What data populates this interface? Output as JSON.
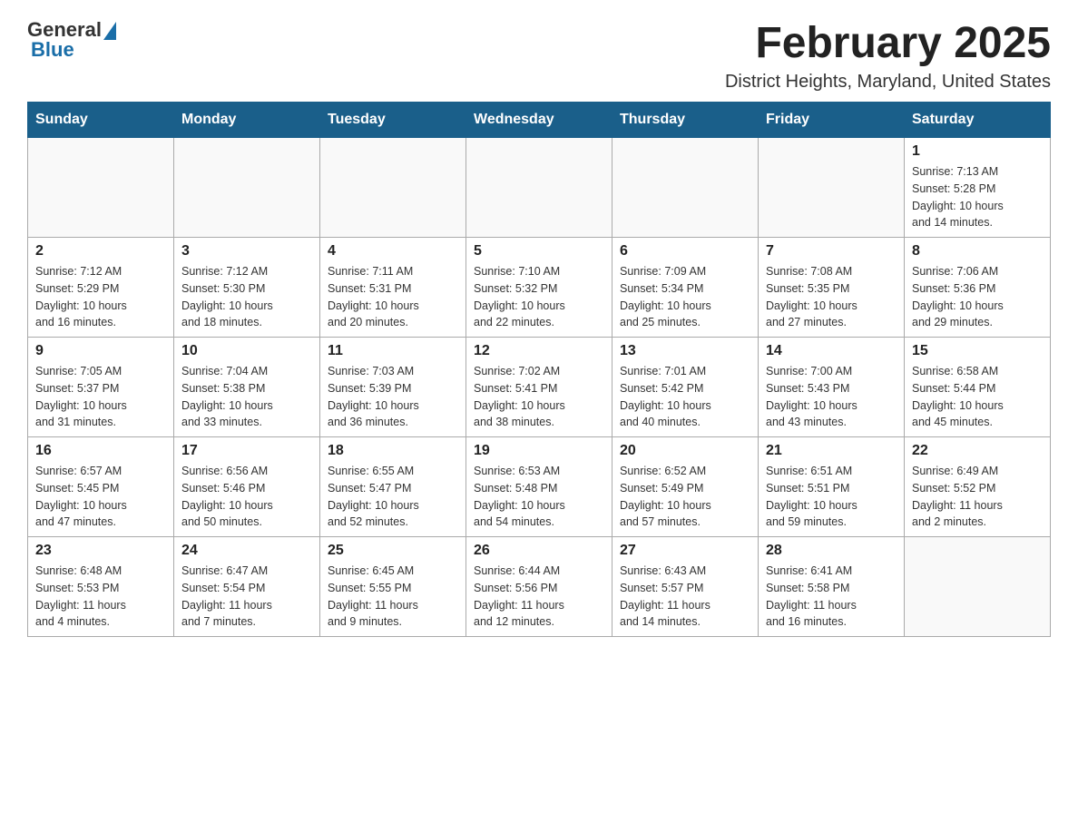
{
  "header": {
    "logo_general": "General",
    "logo_blue": "Blue",
    "title": "February 2025",
    "subtitle": "District Heights, Maryland, United States"
  },
  "days_of_week": [
    "Sunday",
    "Monday",
    "Tuesday",
    "Wednesday",
    "Thursday",
    "Friday",
    "Saturday"
  ],
  "weeks": [
    [
      {
        "day": "",
        "info": ""
      },
      {
        "day": "",
        "info": ""
      },
      {
        "day": "",
        "info": ""
      },
      {
        "day": "",
        "info": ""
      },
      {
        "day": "",
        "info": ""
      },
      {
        "day": "",
        "info": ""
      },
      {
        "day": "1",
        "info": "Sunrise: 7:13 AM\nSunset: 5:28 PM\nDaylight: 10 hours\nand 14 minutes."
      }
    ],
    [
      {
        "day": "2",
        "info": "Sunrise: 7:12 AM\nSunset: 5:29 PM\nDaylight: 10 hours\nand 16 minutes."
      },
      {
        "day": "3",
        "info": "Sunrise: 7:12 AM\nSunset: 5:30 PM\nDaylight: 10 hours\nand 18 minutes."
      },
      {
        "day": "4",
        "info": "Sunrise: 7:11 AM\nSunset: 5:31 PM\nDaylight: 10 hours\nand 20 minutes."
      },
      {
        "day": "5",
        "info": "Sunrise: 7:10 AM\nSunset: 5:32 PM\nDaylight: 10 hours\nand 22 minutes."
      },
      {
        "day": "6",
        "info": "Sunrise: 7:09 AM\nSunset: 5:34 PM\nDaylight: 10 hours\nand 25 minutes."
      },
      {
        "day": "7",
        "info": "Sunrise: 7:08 AM\nSunset: 5:35 PM\nDaylight: 10 hours\nand 27 minutes."
      },
      {
        "day": "8",
        "info": "Sunrise: 7:06 AM\nSunset: 5:36 PM\nDaylight: 10 hours\nand 29 minutes."
      }
    ],
    [
      {
        "day": "9",
        "info": "Sunrise: 7:05 AM\nSunset: 5:37 PM\nDaylight: 10 hours\nand 31 minutes."
      },
      {
        "day": "10",
        "info": "Sunrise: 7:04 AM\nSunset: 5:38 PM\nDaylight: 10 hours\nand 33 minutes."
      },
      {
        "day": "11",
        "info": "Sunrise: 7:03 AM\nSunset: 5:39 PM\nDaylight: 10 hours\nand 36 minutes."
      },
      {
        "day": "12",
        "info": "Sunrise: 7:02 AM\nSunset: 5:41 PM\nDaylight: 10 hours\nand 38 minutes."
      },
      {
        "day": "13",
        "info": "Sunrise: 7:01 AM\nSunset: 5:42 PM\nDaylight: 10 hours\nand 40 minutes."
      },
      {
        "day": "14",
        "info": "Sunrise: 7:00 AM\nSunset: 5:43 PM\nDaylight: 10 hours\nand 43 minutes."
      },
      {
        "day": "15",
        "info": "Sunrise: 6:58 AM\nSunset: 5:44 PM\nDaylight: 10 hours\nand 45 minutes."
      }
    ],
    [
      {
        "day": "16",
        "info": "Sunrise: 6:57 AM\nSunset: 5:45 PM\nDaylight: 10 hours\nand 47 minutes."
      },
      {
        "day": "17",
        "info": "Sunrise: 6:56 AM\nSunset: 5:46 PM\nDaylight: 10 hours\nand 50 minutes."
      },
      {
        "day": "18",
        "info": "Sunrise: 6:55 AM\nSunset: 5:47 PM\nDaylight: 10 hours\nand 52 minutes."
      },
      {
        "day": "19",
        "info": "Sunrise: 6:53 AM\nSunset: 5:48 PM\nDaylight: 10 hours\nand 54 minutes."
      },
      {
        "day": "20",
        "info": "Sunrise: 6:52 AM\nSunset: 5:49 PM\nDaylight: 10 hours\nand 57 minutes."
      },
      {
        "day": "21",
        "info": "Sunrise: 6:51 AM\nSunset: 5:51 PM\nDaylight: 10 hours\nand 59 minutes."
      },
      {
        "day": "22",
        "info": "Sunrise: 6:49 AM\nSunset: 5:52 PM\nDaylight: 11 hours\nand 2 minutes."
      }
    ],
    [
      {
        "day": "23",
        "info": "Sunrise: 6:48 AM\nSunset: 5:53 PM\nDaylight: 11 hours\nand 4 minutes."
      },
      {
        "day": "24",
        "info": "Sunrise: 6:47 AM\nSunset: 5:54 PM\nDaylight: 11 hours\nand 7 minutes."
      },
      {
        "day": "25",
        "info": "Sunrise: 6:45 AM\nSunset: 5:55 PM\nDaylight: 11 hours\nand 9 minutes."
      },
      {
        "day": "26",
        "info": "Sunrise: 6:44 AM\nSunset: 5:56 PM\nDaylight: 11 hours\nand 12 minutes."
      },
      {
        "day": "27",
        "info": "Sunrise: 6:43 AM\nSunset: 5:57 PM\nDaylight: 11 hours\nand 14 minutes."
      },
      {
        "day": "28",
        "info": "Sunrise: 6:41 AM\nSunset: 5:58 PM\nDaylight: 11 hours\nand 16 minutes."
      },
      {
        "day": "",
        "info": ""
      }
    ]
  ]
}
